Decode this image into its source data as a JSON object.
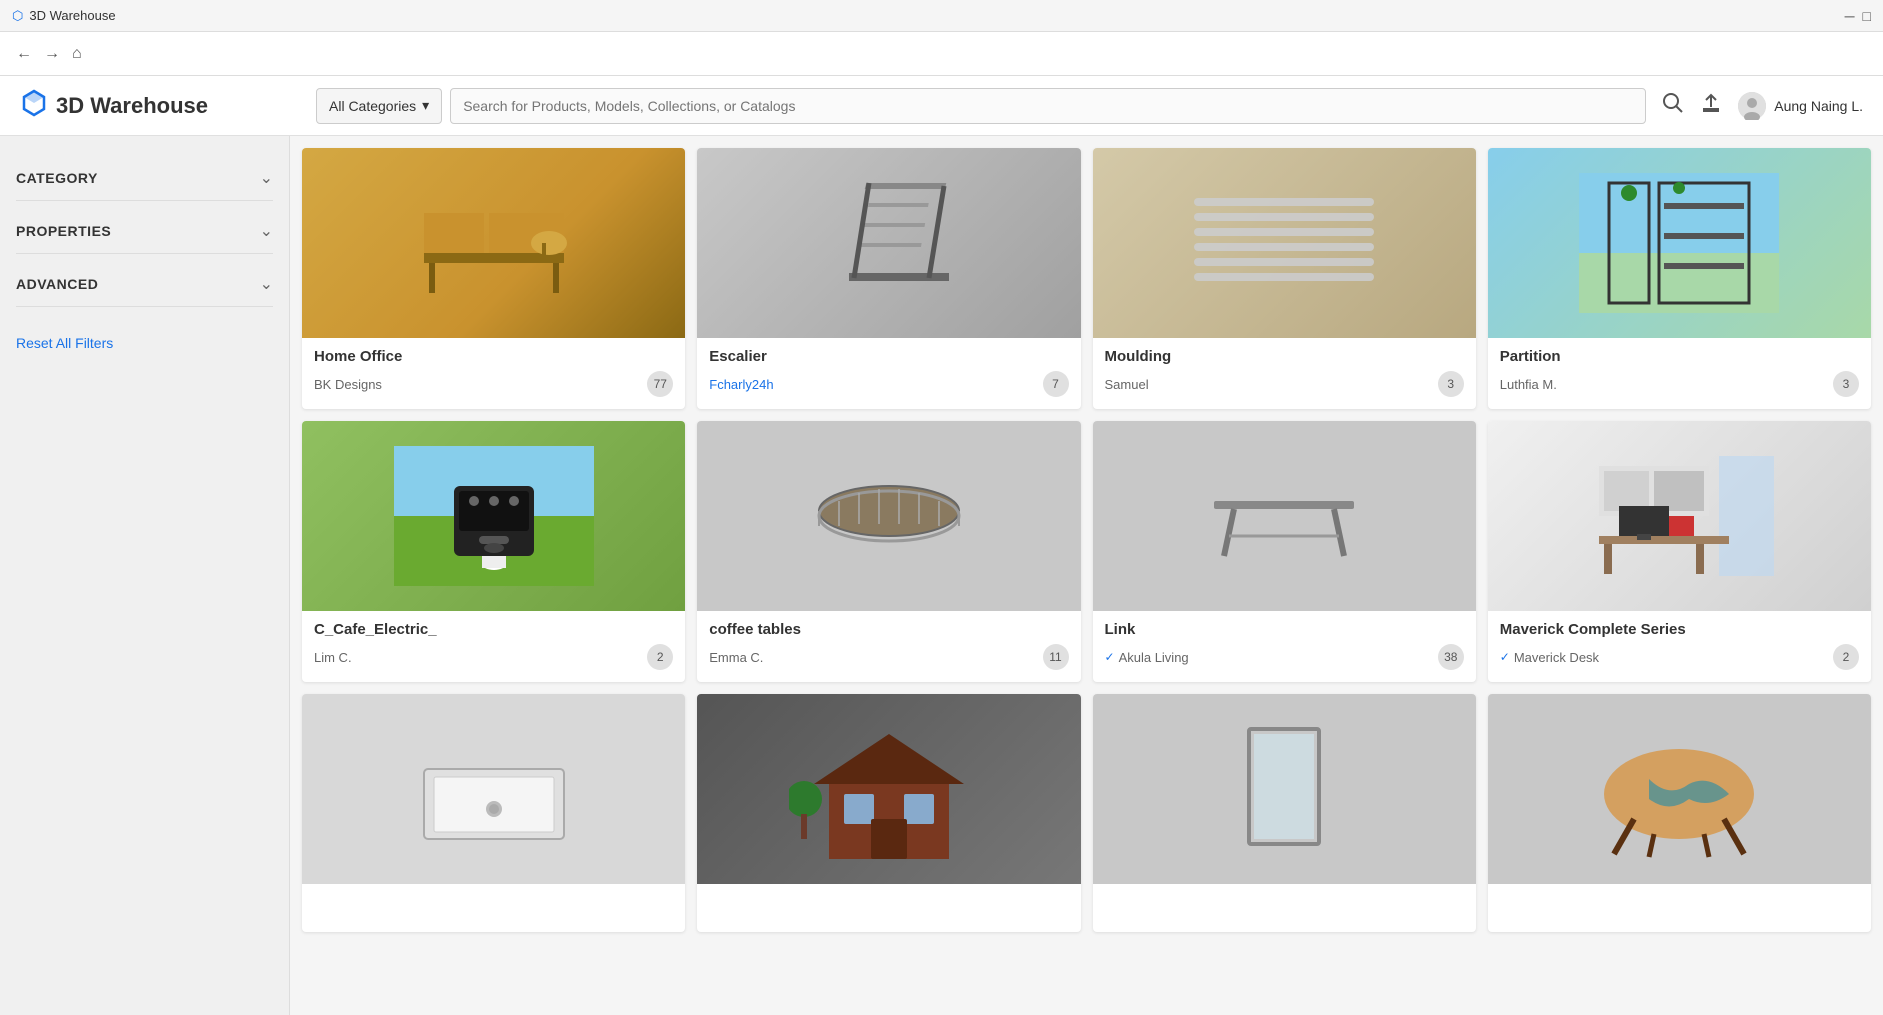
{
  "titleBar": {
    "appName": "3D Warehouse",
    "icon": "⬡"
  },
  "nav": {
    "backIcon": "←",
    "forwardIcon": "→",
    "homeIcon": "⌂"
  },
  "header": {
    "logoText": "3D Warehouse",
    "categoryButton": "All Categories",
    "searchPlaceholder": "Search for Products, Models, Collections, or Catalogs",
    "userName": "Aung Naing L.",
    "uploadIcon": "⬆",
    "searchIcon": "🔍"
  },
  "sidebar": {
    "filters": [
      {
        "id": "category",
        "label": "CATEGORY",
        "expanded": false
      },
      {
        "id": "properties",
        "label": "PROPERTIES",
        "expanded": false
      },
      {
        "id": "advanced",
        "label": "ADVANCED",
        "expanded": false
      }
    ],
    "resetLabel": "Reset All Filters"
  },
  "grid": {
    "cards": [
      {
        "id": "home-office",
        "title": "Home Office",
        "author": "BK Designs",
        "count": "77",
        "verified": false,
        "bgClass": "bg-home-office",
        "emoji": "🪑"
      },
      {
        "id": "escalier",
        "title": "Escalier",
        "author": "Fcharly24h",
        "count": "7",
        "verified": false,
        "bgClass": "bg-escalier",
        "emoji": "🪜",
        "authorColor": "#1a73e8"
      },
      {
        "id": "moulding",
        "title": "Moulding",
        "author": "Samuel",
        "count": "3",
        "verified": false,
        "bgClass": "bg-moulding",
        "emoji": "📐"
      },
      {
        "id": "partition",
        "title": "Partition",
        "author": "Luthfia M.",
        "count": "3",
        "verified": false,
        "bgClass": "bg-partition",
        "emoji": "🚪"
      },
      {
        "id": "cafe-electric",
        "title": "C_Cafe_Electric_",
        "author": "Lim C.",
        "count": "2",
        "verified": false,
        "bgClass": "bg-cafe",
        "emoji": "☕"
      },
      {
        "id": "coffee-tables",
        "title": "coffee tables",
        "author": "Emma C.",
        "count": "11",
        "verified": false,
        "bgClass": "bg-coffee",
        "emoji": "🫘"
      },
      {
        "id": "link",
        "title": "Link",
        "author": "Akula Living",
        "count": "38",
        "verified": true,
        "bgClass": "bg-link",
        "emoji": "🪑"
      },
      {
        "id": "maverick",
        "title": "Maverick Complete Series",
        "author": "Maverick Desk",
        "count": "2",
        "verified": true,
        "bgClass": "bg-maverick",
        "emoji": "🖥"
      },
      {
        "id": "shower",
        "title": "",
        "author": "",
        "count": "",
        "verified": false,
        "bgClass": "bg-shower",
        "emoji": "🛁"
      },
      {
        "id": "house",
        "title": "",
        "author": "",
        "count": "",
        "verified": false,
        "bgClass": "bg-house",
        "emoji": "🏠"
      },
      {
        "id": "mirror",
        "title": "",
        "author": "",
        "count": "",
        "verified": false,
        "bgClass": "bg-mirror",
        "emoji": "🪟"
      },
      {
        "id": "wood-table",
        "title": "",
        "author": "",
        "count": "",
        "verified": false,
        "bgClass": "bg-table",
        "emoji": "🪵"
      }
    ]
  },
  "colors": {
    "accent": "#1a73e8",
    "verifiedColor": "#1a73e8"
  }
}
